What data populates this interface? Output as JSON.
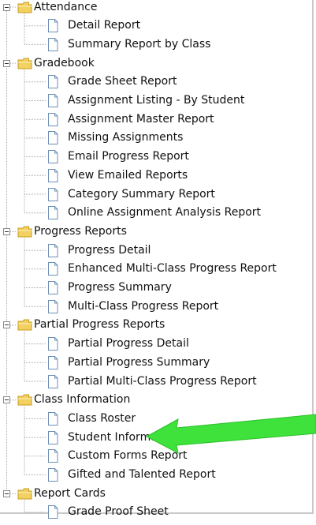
{
  "tree": {
    "categories": [
      {
        "name": "Attendance",
        "items": [
          "Detail Report",
          "Summary Report by Class"
        ]
      },
      {
        "name": "Gradebook",
        "items": [
          "Grade Sheet Report",
          "Assignment Listing - By Student",
          "Assignment Master Report",
          "Missing Assignments",
          "Email Progress Report",
          "View Emailed Reports",
          "Category Summary Report",
          "Online Assignment Analysis Report"
        ]
      },
      {
        "name": "Progress Reports",
        "items": [
          "Progress Detail",
          "Enhanced Multi-Class Progress Report",
          "Progress Summary",
          "Multi-Class Progress Report"
        ]
      },
      {
        "name": "Partial Progress Reports",
        "items": [
          "Partial Progress Detail",
          "Partial Progress Summary",
          "Partial Multi-Class Progress Report"
        ]
      },
      {
        "name": "Class Information",
        "items": [
          "Class Roster",
          "Student Information",
          "Custom Forms Report",
          "Gifted and Talented Report"
        ]
      },
      {
        "name": "Report Cards",
        "items": [
          "Grade Proof Sheet"
        ]
      }
    ]
  },
  "annotation": {
    "arrow_color": "#3ee23a",
    "target_item": "Class Roster"
  },
  "colors": {
    "folder": "#f2d062",
    "doc": "#ffffff",
    "doc_border": "#6c8fb5",
    "tree_line": "#a8a8a8"
  }
}
